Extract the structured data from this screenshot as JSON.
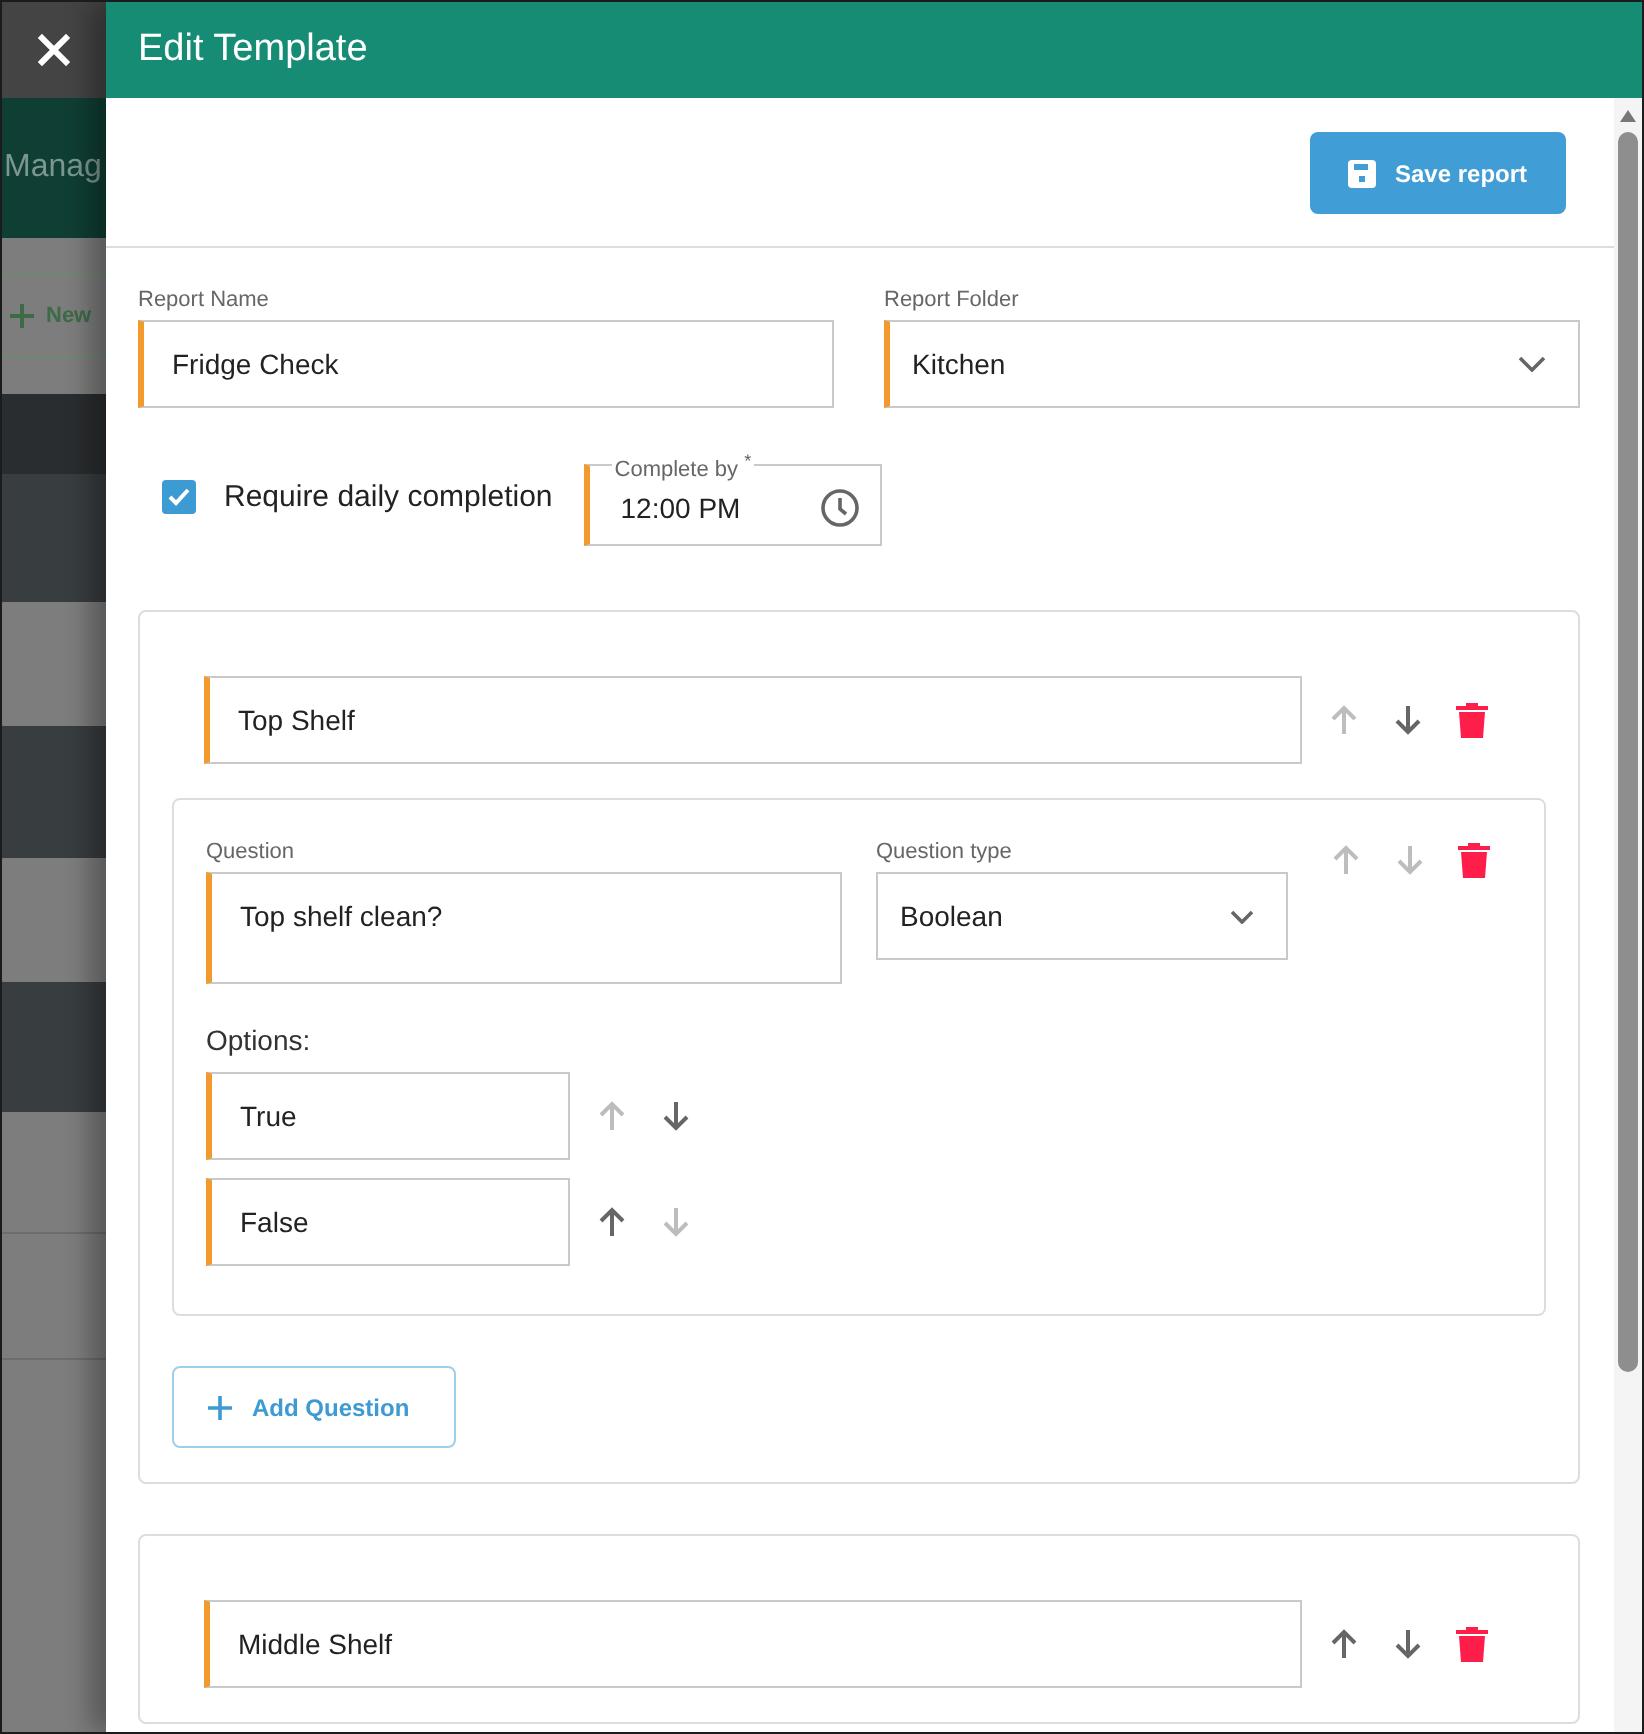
{
  "background_app": {
    "title": "Manag",
    "new_button": "New"
  },
  "dialog": {
    "title": "Edit Template",
    "save_button": "Save report"
  },
  "report_name": {
    "label": "Report Name",
    "value": "Fridge Check",
    "required": true
  },
  "report_folder": {
    "label": "Report Folder",
    "value": "Kitchen",
    "required": true
  },
  "daily_completion": {
    "label": "Require daily completion",
    "checked": true
  },
  "complete_by": {
    "label": "Complete by $^{*}$",
    "value": "12:00 PM",
    "required": true
  },
  "sections": [
    {
      "title": "Top Shelf",
      "title_required": true,
      "can_move_up": false,
      "can_move_down": true,
      "questions": [
        {
          "question": {
            "label": "Question",
            "value": "Top shelf clean?",
            "required": true
          },
          "type": {
            "label": "Question type",
            "value": "Boolean",
            "required": false
          },
          "can_move_up": false,
          "can_move_down": false,
          "options_label": "Options:",
          "options": [
            {
              "value": "True",
              "required": true,
              "can_move_up": false,
              "can_move_down": true
            },
            {
              "value": "False",
              "required": true,
              "can_move_up": true,
              "can_move_down": false
            }
          ]
        }
      ],
      "add_question_button": "Add Question"
    },
    {
      "title": "Middle Shelf",
      "title_required": true,
      "can_move_up": true,
      "can_move_down": true
    }
  ]
}
